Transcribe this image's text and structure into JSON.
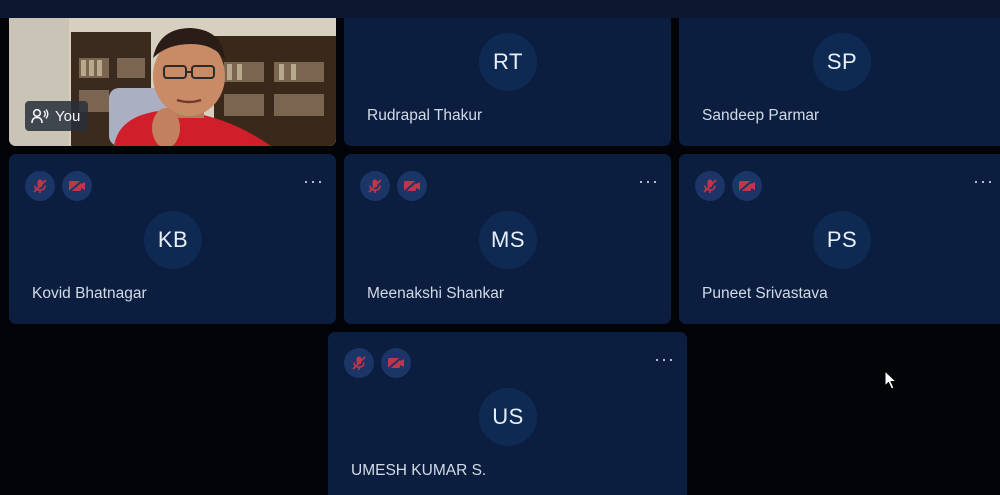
{
  "self": {
    "badge_label": "You",
    "badge_icon": "speaker-icon"
  },
  "participants": [
    {
      "initials": "RT",
      "name": "Rudrapal Thakur"
    },
    {
      "initials": "SP",
      "name": "Sandeep Parmar"
    },
    {
      "initials": "KB",
      "name": "Kovid Bhatnagar"
    },
    {
      "initials": "MS",
      "name": "Meenakshi Shankar"
    },
    {
      "initials": "PS",
      "name": "Puneet Srivastava"
    },
    {
      "initials": "US",
      "name": "UMESH KUMAR S."
    }
  ],
  "controls": {
    "more_label": "···",
    "mic_icon": "mic-muted-icon",
    "camera_icon": "camera-off-icon"
  },
  "colors": {
    "tile_bg": "#0b1e3f",
    "avatar_bg": "#0f2a52",
    "muted_red": "#c0354a",
    "page_bg": "#020408"
  }
}
